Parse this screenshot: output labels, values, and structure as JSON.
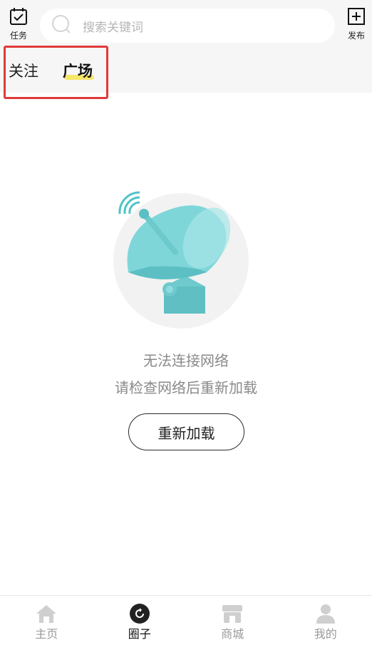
{
  "header": {
    "task_label": "任务",
    "search_placeholder": "搜索关键词",
    "publish_label": "发布"
  },
  "tabs": [
    {
      "label": "关注",
      "active": false
    },
    {
      "label": "广场",
      "active": true
    }
  ],
  "empty_state": {
    "title": "无法连接网络",
    "subtitle": "请检查网络后重新加载",
    "reload_label": "重新加载",
    "illustration_icon": "satellite-dish-icon"
  },
  "bottom_nav": [
    {
      "label": "主页",
      "icon": "home-icon",
      "active": false
    },
    {
      "label": "圈子",
      "icon": "circle-refresh-icon",
      "active": true
    },
    {
      "label": "商城",
      "icon": "store-icon",
      "active": false
    },
    {
      "label": "我的",
      "icon": "user-icon",
      "active": false
    }
  ],
  "colors": {
    "accent_underline": "#f6e66a",
    "highlight_border": "#e03a3a",
    "dish": "#79d3d6"
  }
}
